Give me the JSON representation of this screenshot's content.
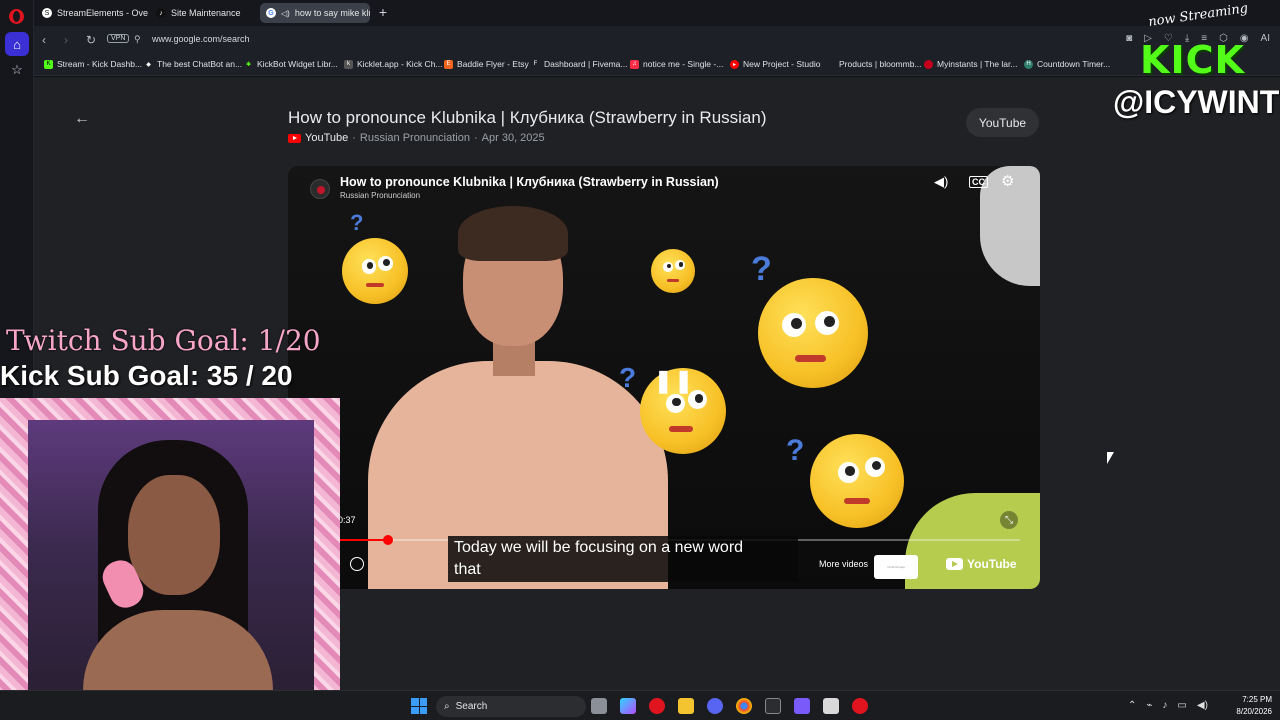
{
  "browser": {
    "tabs": [
      {
        "label": "StreamElements - Overlay",
        "icon": "streamelements-icon",
        "active": false
      },
      {
        "label": "Site Maintenance",
        "icon": "tiktok-icon",
        "active": false
      },
      {
        "label": "how to say mike klubn",
        "icon": "google-icon",
        "active": true
      }
    ],
    "url": "www.google.com/search",
    "vpn_label": "VPN",
    "bookmarks": [
      "Stream - Kick Dashb...",
      "The best ChatBot an...",
      "KickBot Widget Libr...",
      "Kicklet.app - Kick Ch...",
      "Baddie Flyer - Etsy",
      "Dashboard | Fivema...",
      "notice me - Single -...",
      "New Project - Studio",
      "Products | bloommb...",
      "Myinstants | The lar...",
      "Countdown Timer..."
    ]
  },
  "result": {
    "title": "How to pronounce Klubnika | Клубника (Strawberry in Russian)",
    "source_site": "YouTube",
    "separator": "·",
    "channel": "Russian Pronunciation",
    "date": "Apr 30, 2025",
    "youtube_button": "YouTube"
  },
  "player": {
    "title": "How to pronounce Klubnika | Клубника (Strawberry in Russian)",
    "channel": "Russian Pronunciation",
    "time": "0:37",
    "progress": 0.07,
    "caption_line1": "Today we will be focusing on a new word",
    "caption_line2": "that",
    "more_videos": "More videos",
    "logo_text": "YouTube",
    "thumb_text": "Clubnichnaja"
  },
  "overlay": {
    "twitch_goal": "Twitch Sub Goal: 1/20",
    "kick_goal": "Kick Sub Goal: 35 / 20",
    "now_streaming": "now Streaming",
    "kick_label": "KICK",
    "handle": "@ICYWINTRR"
  },
  "taskbar": {
    "search": "Search",
    "time": "7:25 PM",
    "date": "8/20/2026"
  },
  "colors": {
    "kick_green": "#53fc18",
    "youtube_red": "#ff0000",
    "twitch_pink": "#f7a6c9",
    "accent_blue": "#3b2fd6"
  }
}
